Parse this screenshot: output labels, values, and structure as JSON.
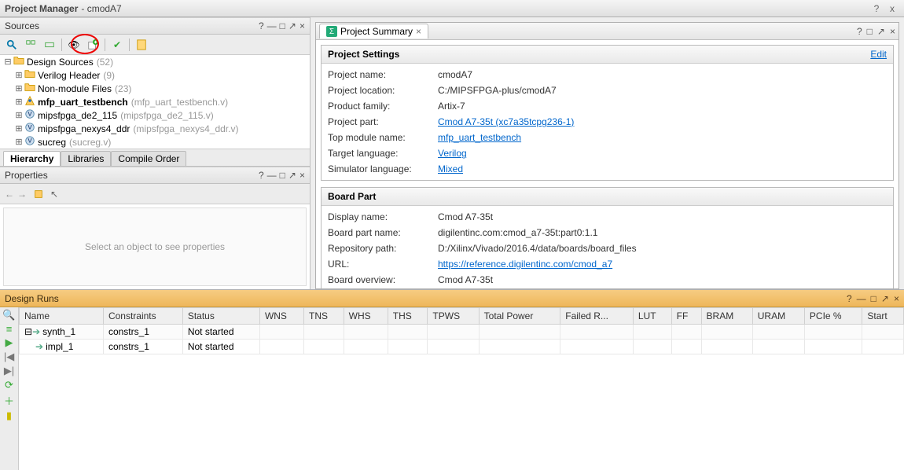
{
  "window": {
    "title_main": "Project Manager",
    "title_sub": "- cmodA7",
    "help": "?",
    "close": "x"
  },
  "sources": {
    "title": "Sources",
    "tree": [
      {
        "label": "Design Sources",
        "count": "(52)",
        "level": 0,
        "exp": "⊟",
        "icon": "folder"
      },
      {
        "label": "Verilog Header",
        "count": "(9)",
        "level": 1,
        "exp": "⊞",
        "icon": "folder"
      },
      {
        "label": "Non-module Files",
        "count": "(23)",
        "level": 1,
        "exp": "⊞",
        "icon": "folder"
      },
      {
        "label": "mfp_uart_testbench",
        "count": "(mfp_uart_testbench.v)",
        "level": 1,
        "exp": "⊞",
        "icon": "top",
        "bold": true
      },
      {
        "label": "mipsfpga_de2_115",
        "count": "(mipsfpga_de2_115.v)",
        "level": 1,
        "exp": "⊞",
        "icon": "mod"
      },
      {
        "label": "mipsfpga_nexys4_ddr",
        "count": "(mipsfpga_nexys4_ddr.v)",
        "level": 1,
        "exp": "⊞",
        "icon": "mod"
      },
      {
        "label": "sucreg",
        "count": "(sucreg.v)",
        "level": 1,
        "exp": "⊞",
        "icon": "mod"
      }
    ],
    "tabs": [
      "Hierarchy",
      "Libraries",
      "Compile Order"
    ]
  },
  "properties": {
    "title": "Properties",
    "placeholder": "Select an object to see properties"
  },
  "summary": {
    "tab_label": "Project Summary",
    "settings": {
      "title": "Project Settings",
      "edit": "Edit",
      "rows": [
        {
          "k": "Project name:",
          "v": "cmodA7"
        },
        {
          "k": "Project location:",
          "v": "C:/MIPSFPGA-plus/cmodA7"
        },
        {
          "k": "Product family:",
          "v": "Artix-7"
        },
        {
          "k": "Project part:",
          "v": "Cmod A7-35t (xc7a35tcpg236-1)",
          "link": true
        },
        {
          "k": "Top module name:",
          "v": "mfp_uart_testbench",
          "link": true
        },
        {
          "k": "Target language:",
          "v": "Verilog",
          "link": true
        },
        {
          "k": "Simulator language:",
          "v": "Mixed",
          "link": true
        }
      ]
    },
    "board": {
      "title": "Board Part",
      "rows": [
        {
          "k": "Display name:",
          "v": "Cmod A7-35t"
        },
        {
          "k": "Board part name:",
          "v": "digilentinc.com:cmod_a7-35t:part0:1.1"
        },
        {
          "k": "Repository path:",
          "v": "D:/Xilinx/Vivado/2016.4/data/boards/board_files"
        },
        {
          "k": "URL:",
          "v": "https://reference.digilentinc.com/cmod_a7",
          "link": true
        },
        {
          "k": "Board overview:",
          "v": "Cmod A7-35t"
        }
      ]
    }
  },
  "runs": {
    "title": "Design Runs",
    "columns": [
      "Name",
      "Constraints",
      "Status",
      "WNS",
      "TNS",
      "WHS",
      "THS",
      "TPWS",
      "Total Power",
      "Failed R...",
      "LUT",
      "FF",
      "BRAM",
      "URAM",
      "PCIe %",
      "Start"
    ],
    "rows": [
      {
        "name": "synth_1",
        "indent": 0,
        "constraints": "constrs_1",
        "status": "Not started"
      },
      {
        "name": "impl_1",
        "indent": 1,
        "constraints": "constrs_1",
        "status": "Not started"
      }
    ]
  }
}
